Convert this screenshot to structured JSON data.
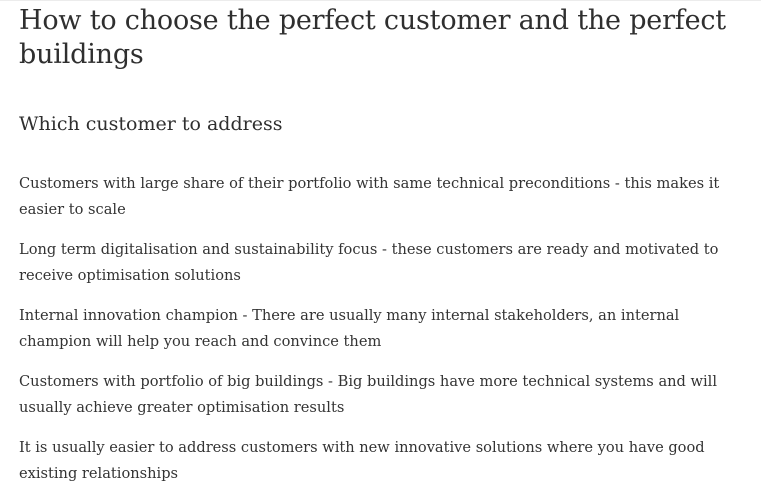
{
  "article": {
    "title": "How to choose the perfect customer and the perfect buildings",
    "section_heading": "Which customer to address",
    "points": [
      "Customers with large share of their portfolio with same technical preconditions - this makes it easier to scale",
      "Long term digitalisation and sustainability focus - these customers are ready and motivated to receive optimisation solutions",
      "Internal innovation champion - There are usually many internal stakeholders, an internal champion will help you reach and convince them",
      "Customers with portfolio of big buildings - Big buildings have more technical systems and will usually achieve greater optimisation results",
      "It is usually easier to address customers with new innovative solutions where you have good existing relationships"
    ]
  }
}
